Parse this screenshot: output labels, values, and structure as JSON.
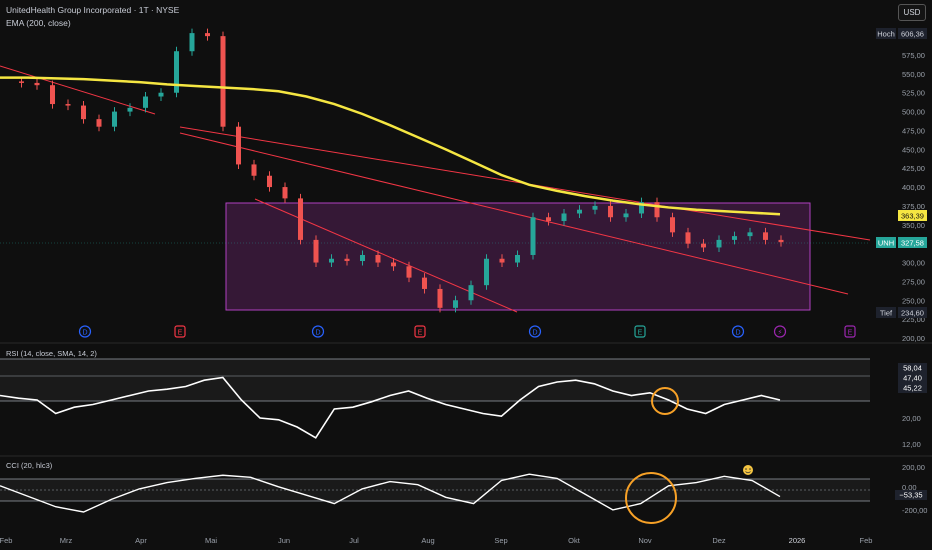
{
  "header": {
    "title": "UnitedHealth Group Incorporated · 1T · NYSE",
    "indicator": "EMA (200, close)",
    "currency": "USD"
  },
  "colors": {
    "up": "#26a69a",
    "down": "#ef5350",
    "ema": "#f5e642",
    "trend": "#f23645",
    "box_fill": "#4a1d4a",
    "box_stroke": "#b040c0",
    "osc_line": "#ffffff",
    "marker_orange": "#f7a127"
  },
  "price_axis": {
    "ticks": [
      "606,36",
      "575,00",
      "550,00",
      "525,00",
      "500,00",
      "475,00",
      "450,00",
      "425,00",
      "400,00",
      "375,00",
      "350,00",
      "325,00",
      "300,00",
      "275,00",
      "250,00",
      "225,00",
      "200,00"
    ],
    "hoch_label": "Hoch",
    "hoch_value": "606,36",
    "ema_value": "363,39",
    "ticker": "UNH",
    "last_value": "327,58",
    "tief_label": "Tief",
    "tief_value": "234,60"
  },
  "rsi": {
    "label": "RSI (14, close, SMA, 14, 2)",
    "values": [
      "58,04",
      "47,40",
      "45,22"
    ],
    "ticks": [
      "20,00",
      "12,00"
    ]
  },
  "cci": {
    "label": "CCI (20, hlc3)",
    "ticks": [
      "200,00",
      "0,00",
      "-200,00"
    ],
    "value": "−53,35"
  },
  "time_axis": [
    "Feb",
    "Mrz",
    "Apr",
    "Mai",
    "Jun",
    "Jul",
    "Aug",
    "Sep",
    "Okt",
    "Nov",
    "Dez",
    "2026",
    "Feb"
  ],
  "events": [
    {
      "type": "D",
      "color": "#2962ff"
    },
    {
      "type": "E",
      "color": "#f23645"
    },
    {
      "type": "D",
      "color": "#2962ff"
    },
    {
      "type": "E",
      "color": "#f23645"
    },
    {
      "type": "D",
      "color": "#2962ff"
    },
    {
      "type": "E",
      "color": "#26a69a"
    },
    {
      "type": "D",
      "color": "#2962ff"
    },
    {
      "type": "⚡",
      "color": "#9c27b0"
    },
    {
      "type": "E",
      "color": "#9c27b0"
    }
  ],
  "chart_data": {
    "type": "candlestick",
    "price_ylim": [
      200,
      620
    ],
    "ema200": [
      [
        0,
        545
      ],
      [
        1,
        545
      ],
      [
        2,
        544
      ],
      [
        3,
        543
      ],
      [
        4,
        541
      ],
      [
        5,
        539
      ],
      [
        6,
        536
      ],
      [
        7,
        534
      ],
      [
        8,
        532
      ],
      [
        9,
        530
      ],
      [
        10,
        527
      ],
      [
        11,
        520
      ],
      [
        12,
        510
      ],
      [
        13,
        497
      ],
      [
        14,
        482
      ],
      [
        15,
        466
      ],
      [
        16,
        450
      ],
      [
        17,
        433
      ],
      [
        18,
        416
      ],
      [
        19,
        403
      ],
      [
        20,
        395
      ],
      [
        21,
        388
      ],
      [
        22,
        382
      ],
      [
        23,
        377
      ],
      [
        24,
        373
      ],
      [
        25,
        370
      ],
      [
        26,
        368
      ],
      [
        27,
        366
      ],
      [
        28,
        364
      ]
    ],
    "closes": [
      [
        0,
        540
      ],
      [
        1,
        538
      ],
      [
        2,
        535
      ],
      [
        3,
        510
      ],
      [
        4,
        508
      ],
      [
        5,
        490
      ],
      [
        6,
        480
      ],
      [
        7,
        500
      ],
      [
        8,
        505
      ],
      [
        9,
        520
      ],
      [
        10,
        525
      ],
      [
        11,
        580
      ],
      [
        12,
        604
      ],
      [
        13,
        600
      ],
      [
        14,
        480
      ],
      [
        15,
        430
      ],
      [
        16,
        415
      ],
      [
        17,
        400
      ],
      [
        18,
        385
      ],
      [
        19,
        330
      ],
      [
        20,
        300
      ],
      [
        21,
        305
      ],
      [
        22,
        302
      ],
      [
        23,
        310
      ],
      [
        24,
        300
      ],
      [
        25,
        295
      ],
      [
        26,
        280
      ],
      [
        27,
        265
      ],
      [
        28,
        240
      ],
      [
        29,
        250
      ],
      [
        30,
        270
      ],
      [
        31,
        305
      ],
      [
        32,
        300
      ],
      [
        33,
        310
      ],
      [
        34,
        360
      ],
      [
        35,
        355
      ],
      [
        36,
        365
      ],
      [
        37,
        370
      ],
      [
        38,
        375
      ],
      [
        39,
        360
      ],
      [
        40,
        365
      ],
      [
        41,
        380
      ],
      [
        42,
        360
      ],
      [
        43,
        340
      ],
      [
        44,
        325
      ],
      [
        45,
        320
      ],
      [
        46,
        330
      ],
      [
        47,
        335
      ],
      [
        48,
        340
      ],
      [
        49,
        330
      ],
      [
        50,
        327
      ]
    ],
    "rsi": [
      [
        0,
        55
      ],
      [
        1,
        52
      ],
      [
        2,
        50
      ],
      [
        3,
        35
      ],
      [
        4,
        42
      ],
      [
        5,
        45
      ],
      [
        6,
        50
      ],
      [
        7,
        55
      ],
      [
        8,
        60
      ],
      [
        9,
        62
      ],
      [
        10,
        65
      ],
      [
        11,
        72
      ],
      [
        12,
        75
      ],
      [
        13,
        50
      ],
      [
        14,
        30
      ],
      [
        15,
        28
      ],
      [
        16,
        20
      ],
      [
        17,
        8
      ],
      [
        18,
        40
      ],
      [
        19,
        42
      ],
      [
        20,
        48
      ],
      [
        21,
        55
      ],
      [
        22,
        60
      ],
      [
        23,
        52
      ],
      [
        24,
        45
      ],
      [
        25,
        40
      ],
      [
        26,
        35
      ],
      [
        27,
        32
      ],
      [
        28,
        50
      ],
      [
        29,
        65
      ],
      [
        30,
        70
      ],
      [
        31,
        72
      ],
      [
        32,
        68
      ],
      [
        33,
        60
      ],
      [
        34,
        55
      ],
      [
        35,
        58
      ],
      [
        36,
        50
      ],
      [
        37,
        40
      ],
      [
        38,
        35
      ],
      [
        39,
        45
      ],
      [
        40,
        50
      ],
      [
        41,
        55
      ],
      [
        42,
        50
      ]
    ],
    "cci": [
      [
        0,
        50
      ],
      [
        1,
        -50
      ],
      [
        2,
        -150
      ],
      [
        3,
        -200
      ],
      [
        4,
        -80
      ],
      [
        5,
        20
      ],
      [
        6,
        80
      ],
      [
        7,
        120
      ],
      [
        8,
        150
      ],
      [
        9,
        130
      ],
      [
        10,
        40
      ],
      [
        11,
        -40
      ],
      [
        12,
        -120
      ],
      [
        13,
        20
      ],
      [
        14,
        90
      ],
      [
        15,
        60
      ],
      [
        16,
        -60
      ],
      [
        17,
        -120
      ],
      [
        18,
        100
      ],
      [
        19,
        160
      ],
      [
        20,
        120
      ],
      [
        21,
        -30
      ],
      [
        22,
        -180
      ],
      [
        23,
        -120
      ],
      [
        24,
        50
      ],
      [
        25,
        80
      ],
      [
        26,
        140
      ],
      [
        27,
        100
      ],
      [
        28,
        -53
      ]
    ]
  }
}
